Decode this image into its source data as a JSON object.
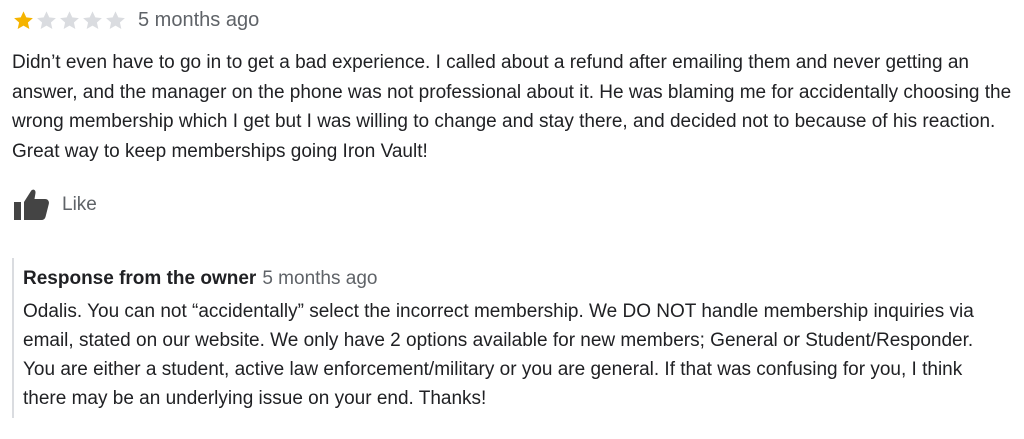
{
  "review": {
    "rating": 1,
    "max_rating": 5,
    "time_ago": "5 months ago",
    "text": "Didn’t even have to go in to get a bad experience. I called about a refund after emailing them and never getting an answer, and the manager on the phone was not professional about it. He was blaming me for accidentally choosing the wrong membership which I get but I was willing to change and stay there, and decided not to because of his reaction. Great way to keep memberships going Iron Vault!",
    "like_label": "Like"
  },
  "owner_response": {
    "title": "Response from the owner",
    "time_ago": "5 months ago",
    "text": "Odalis. You can not “accidentally” select the incorrect membership. We DO NOT handle membership inquiries via email, stated on our website. We only have 2 options available for new members; General or Student/Responder. You are either a student, active law enforcement/military or you are general. If that was confusing for you, I think there may be an underlying issue on your end. Thanks!"
  },
  "colors": {
    "star_filled": "#f5b400",
    "star_empty": "#dadce0",
    "text_primary": "#202124",
    "text_secondary": "#5f6368",
    "border": "#dadce0"
  },
  "icons": {
    "star": "star-icon",
    "like": "thumbs-up-icon"
  }
}
